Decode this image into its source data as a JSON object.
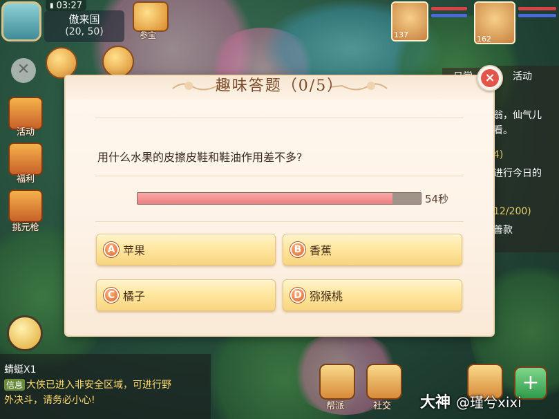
{
  "hud": {
    "time": "03:27",
    "location_name": "傲来国",
    "coordinates": "(20, 50)",
    "top_icon_label": "参宝"
  },
  "side_menu": [
    {
      "label": "活动",
      "icon": "horn-icon"
    },
    {
      "label": "福利",
      "icon": "gift-icon"
    },
    {
      "label": "挑元枪",
      "icon": "banner-icon"
    }
  ],
  "portraits": [
    {
      "level": "137",
      "icon": "pet-avatar-icon"
    },
    {
      "level": "162",
      "icon": "player-avatar-icon"
    }
  ],
  "quest_panel": {
    "tabs": [
      "日常",
      "活动"
    ],
    "lines": [
      {
        "text": "翁，仙气儿",
        "color": "white"
      },
      {
        "text": "看。",
        "color": "white"
      },
      {
        "text": "4)",
        "color": "yellow"
      },
      {
        "text": "进行今日的",
        "color": "white"
      },
      {
        "text": "12/200)",
        "color": "yellow"
      },
      {
        "text": "善款",
        "color": "white"
      }
    ]
  },
  "quiz": {
    "title": "趣味答题（0/5）",
    "progress_current": 0,
    "progress_total": 5,
    "question": "用什么水果的皮擦皮鞋和鞋油作用差不多?",
    "timer_label": "54秒",
    "timer_fraction": 0.9,
    "options": [
      {
        "letter": "A",
        "text": "苹果"
      },
      {
        "letter": "B",
        "text": "香蕉"
      },
      {
        "letter": "C",
        "text": "橘子"
      },
      {
        "letter": "D",
        "text": "猕猴桃"
      }
    ],
    "close_symbol": "×"
  },
  "chat": {
    "lines": [
      {
        "tag": "",
        "text": "蜻蜓X1"
      },
      {
        "tag": "信息",
        "text": "大侠已进入非安全区域，可进行野"
      },
      {
        "tag": "",
        "text": "外决斗，请务必小心!"
      }
    ]
  },
  "bottom_buttons": [
    {
      "label": "帮派",
      "icon": "guild-icon"
    },
    {
      "label": "社交",
      "icon": "social-icon"
    }
  ],
  "watermark": {
    "brand": "大神",
    "handle": "@瑾兮xixi"
  },
  "colors": {
    "timer_fill": "#ec7f80",
    "timer_track": "#a0938a",
    "option_bg": "#ffe7a0",
    "close_red": "#e2564a",
    "title_brown": "#7a4a2a"
  }
}
